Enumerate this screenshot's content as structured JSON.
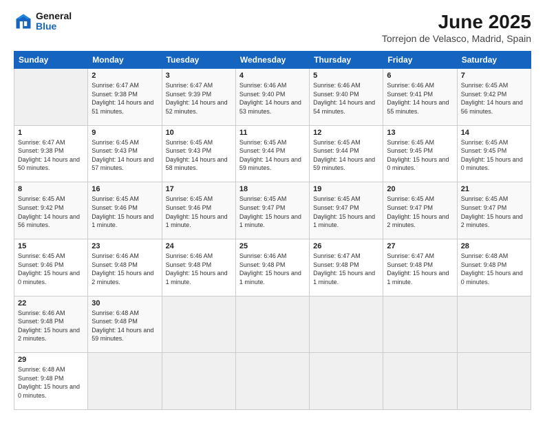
{
  "header": {
    "logo_line1": "General",
    "logo_line2": "Blue",
    "title": "June 2025",
    "subtitle": "Torrejon de Velasco, Madrid, Spain"
  },
  "calendar": {
    "headers": [
      "Sunday",
      "Monday",
      "Tuesday",
      "Wednesday",
      "Thursday",
      "Friday",
      "Saturday"
    ],
    "weeks": [
      [
        {
          "day": "",
          "info": ""
        },
        {
          "day": "2",
          "info": "Sunrise: 6:47 AM\nSunset: 9:38 PM\nDaylight: 14 hours and 51 minutes."
        },
        {
          "day": "3",
          "info": "Sunrise: 6:47 AM\nSunset: 9:39 PM\nDaylight: 14 hours and 52 minutes."
        },
        {
          "day": "4",
          "info": "Sunrise: 6:46 AM\nSunset: 9:40 PM\nDaylight: 14 hours and 53 minutes."
        },
        {
          "day": "5",
          "info": "Sunrise: 6:46 AM\nSunset: 9:40 PM\nDaylight: 14 hours and 54 minutes."
        },
        {
          "day": "6",
          "info": "Sunrise: 6:46 AM\nSunset: 9:41 PM\nDaylight: 14 hours and 55 minutes."
        },
        {
          "day": "7",
          "info": "Sunrise: 6:45 AM\nSunset: 9:42 PM\nDaylight: 14 hours and 56 minutes."
        }
      ],
      [
        {
          "day": "1",
          "info": "Sunrise: 6:47 AM\nSunset: 9:38 PM\nDaylight: 14 hours and 50 minutes."
        },
        {
          "day": "9",
          "info": "Sunrise: 6:45 AM\nSunset: 9:43 PM\nDaylight: 14 hours and 57 minutes."
        },
        {
          "day": "10",
          "info": "Sunrise: 6:45 AM\nSunset: 9:43 PM\nDaylight: 14 hours and 58 minutes."
        },
        {
          "day": "11",
          "info": "Sunrise: 6:45 AM\nSunset: 9:44 PM\nDaylight: 14 hours and 59 minutes."
        },
        {
          "day": "12",
          "info": "Sunrise: 6:45 AM\nSunset: 9:44 PM\nDaylight: 14 hours and 59 minutes."
        },
        {
          "day": "13",
          "info": "Sunrise: 6:45 AM\nSunset: 9:45 PM\nDaylight: 15 hours and 0 minutes."
        },
        {
          "day": "14",
          "info": "Sunrise: 6:45 AM\nSunset: 9:45 PM\nDaylight: 15 hours and 0 minutes."
        }
      ],
      [
        {
          "day": "8",
          "info": "Sunrise: 6:45 AM\nSunset: 9:42 PM\nDaylight: 14 hours and 56 minutes."
        },
        {
          "day": "16",
          "info": "Sunrise: 6:45 AM\nSunset: 9:46 PM\nDaylight: 15 hours and 1 minute."
        },
        {
          "day": "17",
          "info": "Sunrise: 6:45 AM\nSunset: 9:46 PM\nDaylight: 15 hours and 1 minute."
        },
        {
          "day": "18",
          "info": "Sunrise: 6:45 AM\nSunset: 9:47 PM\nDaylight: 15 hours and 1 minute."
        },
        {
          "day": "19",
          "info": "Sunrise: 6:45 AM\nSunset: 9:47 PM\nDaylight: 15 hours and 1 minute."
        },
        {
          "day": "20",
          "info": "Sunrise: 6:45 AM\nSunset: 9:47 PM\nDaylight: 15 hours and 2 minutes."
        },
        {
          "day": "21",
          "info": "Sunrise: 6:45 AM\nSunset: 9:47 PM\nDaylight: 15 hours and 2 minutes."
        }
      ],
      [
        {
          "day": "15",
          "info": "Sunrise: 6:45 AM\nSunset: 9:46 PM\nDaylight: 15 hours and 0 minutes."
        },
        {
          "day": "23",
          "info": "Sunrise: 6:46 AM\nSunset: 9:48 PM\nDaylight: 15 hours and 2 minutes."
        },
        {
          "day": "24",
          "info": "Sunrise: 6:46 AM\nSunset: 9:48 PM\nDaylight: 15 hours and 1 minute."
        },
        {
          "day": "25",
          "info": "Sunrise: 6:46 AM\nSunset: 9:48 PM\nDaylight: 15 hours and 1 minute."
        },
        {
          "day": "26",
          "info": "Sunrise: 6:47 AM\nSunset: 9:48 PM\nDaylight: 15 hours and 1 minute."
        },
        {
          "day": "27",
          "info": "Sunrise: 6:47 AM\nSunset: 9:48 PM\nDaylight: 15 hours and 1 minute."
        },
        {
          "day": "28",
          "info": "Sunrise: 6:48 AM\nSunset: 9:48 PM\nDaylight: 15 hours and 0 minutes."
        }
      ],
      [
        {
          "day": "22",
          "info": "Sunrise: 6:46 AM\nSunset: 9:48 PM\nDaylight: 15 hours and 2 minutes."
        },
        {
          "day": "30",
          "info": "Sunrise: 6:48 AM\nSunset: 9:48 PM\nDaylight: 14 hours and 59 minutes."
        },
        {
          "day": "",
          "info": ""
        },
        {
          "day": "",
          "info": ""
        },
        {
          "day": "",
          "info": ""
        },
        {
          "day": "",
          "info": ""
        },
        {
          "day": "",
          "info": ""
        }
      ],
      [
        {
          "day": "29",
          "info": "Sunrise: 6:48 AM\nSunset: 9:48 PM\nDaylight: 15 hours and 0 minutes."
        },
        {
          "day": "",
          "info": ""
        },
        {
          "day": "",
          "info": ""
        },
        {
          "day": "",
          "info": ""
        },
        {
          "day": "",
          "info": ""
        },
        {
          "day": "",
          "info": ""
        },
        {
          "day": "",
          "info": ""
        }
      ]
    ]
  }
}
